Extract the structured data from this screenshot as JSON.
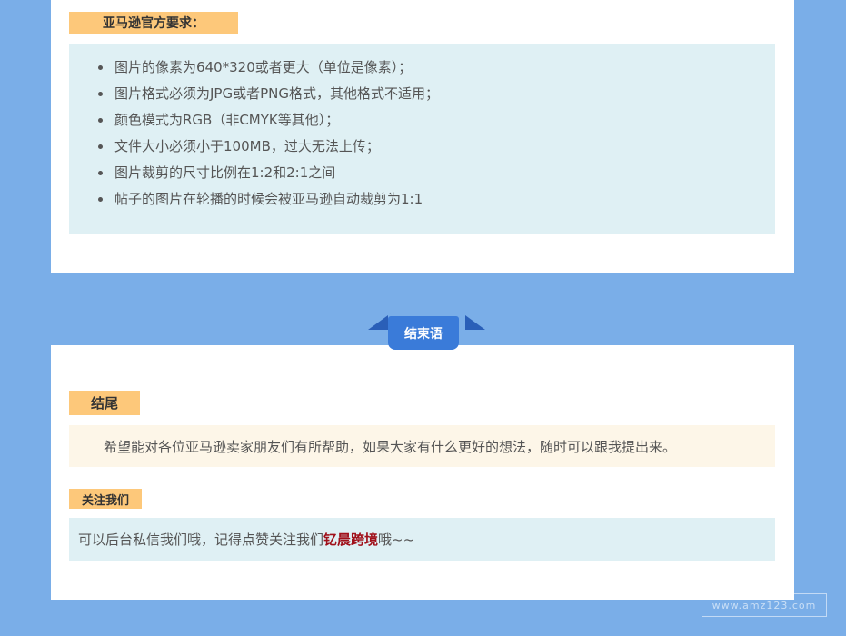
{
  "requirements": {
    "heading": "亚马逊官方要求：",
    "items": [
      " 图片的像素为640*320或者更大（单位是像素）；",
      "图片格式必须为JPG或者PNG格式，其他格式不适用；",
      "颜色模式为RGB（非CMYK等其他）；",
      "文件大小必须小于100MB，过大无法上传；",
      "图片裁剪的尺寸比例在1:2和2:1之间",
      "帖子的图片在轮播的时候会被亚马逊自动裁剪为1:1"
    ]
  },
  "conclusion": {
    "banner": "结束语",
    "heading": "结尾",
    "text": "希望能对各位亚马逊卖家朋友们有所帮助，如果大家有什么更好的想法，随时可以跟我提出来。"
  },
  "follow": {
    "heading": "关注我们",
    "text_before": "可以后台私信我们哦，记得点赞关注我们",
    "brand": "钇晨跨境",
    "text_after": "哦~~"
  },
  "watermark": "www.amz123.com",
  "colors": {
    "page_background": "#7aaee8",
    "tag": "#fdc87a",
    "light_blue_box": "#dff0f4",
    "cream_box": "#fdf6e8",
    "banner": "#3a7bd9",
    "brand_text": "#a0101a"
  }
}
